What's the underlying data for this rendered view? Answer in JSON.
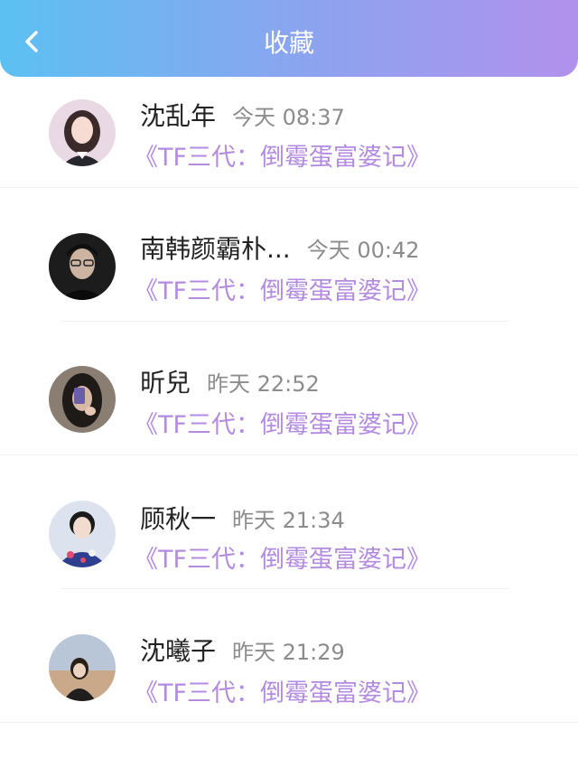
{
  "header": {
    "title": "收藏",
    "back_icon": "chevron-left-icon",
    "gradient": [
      "#5cc0f2",
      "#b191ec"
    ]
  },
  "favorites": [
    {
      "name": "沈乱年",
      "time": "今天 08:37",
      "book": "《TF三代：倒霉蛋富婆记》"
    },
    {
      "name": "南韩颜霸朴...",
      "time": "今天 00:42",
      "book": "《TF三代：倒霉蛋富婆记》"
    },
    {
      "name": "昕兒",
      "time": "昨天 22:52",
      "book": "《TF三代：倒霉蛋富婆记》"
    },
    {
      "name": "顾秋一",
      "time": "昨天 21:34",
      "book": "《TF三代：倒霉蛋富婆记》"
    },
    {
      "name": "沈曦子",
      "time": "昨天 21:29",
      "book": "《TF三代：倒霉蛋富婆记》"
    }
  ],
  "colors": {
    "book_title": "#b38be0",
    "time": "#8c8c8c"
  }
}
